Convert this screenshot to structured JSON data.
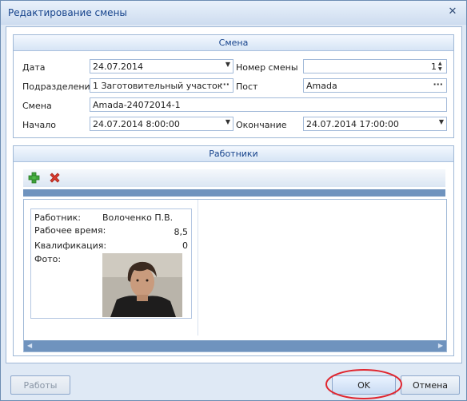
{
  "window": {
    "title": "Редактирование смены",
    "close_glyph": "✕"
  },
  "shift_group": {
    "header": "Смена",
    "date_label": "Дата",
    "date_value": "24.07.2014",
    "shift_number_label": "Номер смены",
    "shift_number_value": "1",
    "division_label": "Подразделение",
    "division_value": "1 Заготовительный участок",
    "post_label": "Пост",
    "post_value": "Amada",
    "shift_label": "Смена",
    "shift_value": "Amada-24072014-1",
    "start_label": "Начало",
    "start_value": "24.07.2014 8:00:00",
    "end_label": "Окончание",
    "end_value": "24.07.2014 17:00:00",
    "dropdown_glyph": "▼",
    "ellipsis_glyph": "···"
  },
  "workers_group": {
    "header": "Работники",
    "add_icon": "plus-icon",
    "delete_icon": "x-icon",
    "card": {
      "worker_label": "Работник:",
      "worker_value": "Волоченко П.В.",
      "work_time_label": "Рабочее время:",
      "work_time_value": "8,5",
      "qualification_label": "Квалификация:",
      "qualification_value": "0",
      "photo_label": "Фото:"
    }
  },
  "buttons": {
    "works": "Работы",
    "ok": "OK",
    "cancel": "Отмена"
  },
  "colors": {
    "accent": "#15428b",
    "highlight_ring": "#e0262f"
  }
}
